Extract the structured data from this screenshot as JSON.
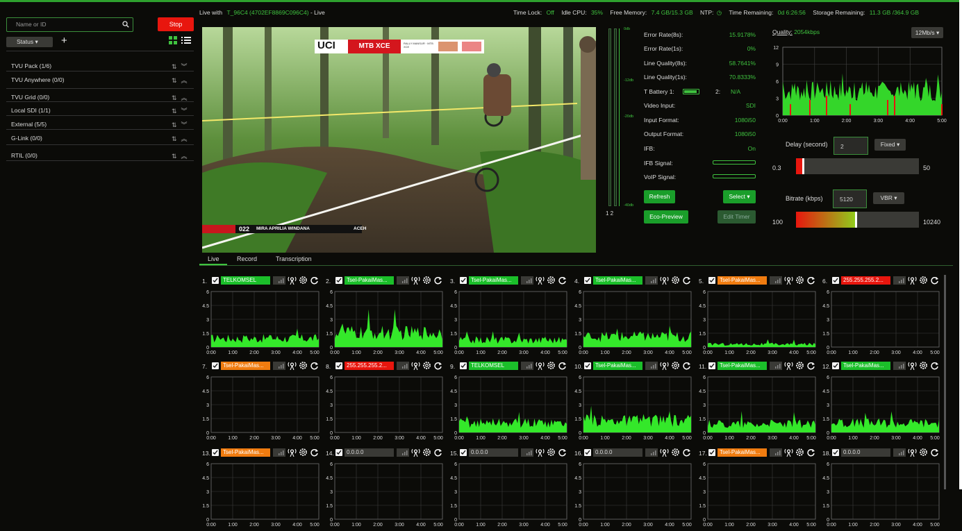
{
  "search": {
    "placeholder": "Name or ID"
  },
  "stop_label": "Stop",
  "status_label": "Status",
  "nav": [
    {
      "label": "TVU Pack (1/6)",
      "expanded": false
    },
    {
      "label": "TVU Anywhere (0/0)",
      "expanded": true
    },
    {
      "label": "TVU Grid (0/0)",
      "expanded": true
    },
    {
      "label": "Local SDI (1/1)",
      "expanded": false
    },
    {
      "label": "External (5/5)",
      "expanded": false
    },
    {
      "label": "G-Link (0/0)",
      "expanded": true
    },
    {
      "label": "RTIL (0/0)",
      "expanded": true
    }
  ],
  "topbar": {
    "live_with_label": "Live with",
    "device": "T_96C4 (4702EF8869C096C4)",
    "live_suffix": "- Live",
    "time_lock_label": "Time Lock:",
    "time_lock": "Off",
    "idle_cpu_label": "Idle CPU:",
    "idle_cpu": "35%",
    "free_memory_label": "Free Memory:",
    "free_memory": "7.4 GB/15.3 GB",
    "ntp_label": "NTP:",
    "time_remaining_label": "Time Remaining:",
    "time_remaining": "0d 6:26:56",
    "storage_remaining_label": "Storage Remaining:",
    "storage_remaining": "11.3 GB /364.9 GB"
  },
  "video": {
    "bug_uci": "UCI",
    "bug_event": "MTB XCE",
    "bug_small": "RALLY MANSUR · MTB XCE",
    "lower_number": "022",
    "lower_name": "MIRA APRILIA WINDANA",
    "lower_team": "ACEH"
  },
  "vu": {
    "ticks": [
      "0db",
      "-12db",
      "-20db",
      "-40db"
    ],
    "channels": "1 2"
  },
  "stats": [
    {
      "label": "Error Rate(8s):",
      "value": "15.9178%"
    },
    {
      "label": "Error Rate(1s):",
      "value": "0%"
    },
    {
      "label": "Line Quality(8s):",
      "value": "58.7641%"
    },
    {
      "label": "Line Quality(1s):",
      "value": "70.8333%"
    },
    {
      "label": "T Battery 1:",
      "value": "N/A",
      "extra": "2:"
    },
    {
      "label": "Video Input:",
      "value": "SDI"
    },
    {
      "label": "Input Format:",
      "value": "1080i50"
    },
    {
      "label": "Output Format:",
      "value": "1080i50"
    },
    {
      "label": "IFB:",
      "value": "On"
    },
    {
      "label": "IFB Signal:",
      "value": ""
    },
    {
      "label": "VoIP Signal:",
      "value": ""
    }
  ],
  "buttons": {
    "refresh": "Refresh",
    "select": "Select",
    "eco_preview": "Eco-Preview",
    "edit_timer": "Edit Timer"
  },
  "quality": {
    "label": "Quality:",
    "value": "2054kbps",
    "rate_select": "12Mb/s",
    "y_ticks": [
      "12",
      "9",
      "6",
      "3",
      "0"
    ],
    "x_ticks": [
      "0:00",
      "1:00",
      "2:00",
      "3:00",
      "4:00",
      "5:00"
    ]
  },
  "delay": {
    "label": "Delay (second)",
    "value": "2",
    "mode": "Fixed",
    "min": "0.3",
    "max": "50",
    "level": 0.06
  },
  "bitrate": {
    "label": "Bitrate (kbps)",
    "value": "5120",
    "mode": "VBR",
    "min": "100",
    "max": "10240",
    "level": 0.49
  },
  "tabs": [
    "Live",
    "Record",
    "Transcription"
  ],
  "small_chart": {
    "y_ticks": [
      "6",
      "4.5",
      "3",
      "1.5",
      "0"
    ],
    "x_ticks": [
      "0:00",
      "1:00",
      "2:00",
      "3:00",
      "4:00",
      "5:00"
    ]
  },
  "colors": {
    "green": "#3fc23f",
    "orange": "#f07c10",
    "red": "#e8160e",
    "gray": "#3a3a36"
  },
  "cards": [
    {
      "num": "1.",
      "name": "TELKOMSEL",
      "state": "green",
      "level": 0.18
    },
    {
      "num": "2.",
      "name": "Tsel-PakaiMas...",
      "state": "green",
      "level": 0.3
    },
    {
      "num": "3.",
      "name": "Tsel-PakaiMas...",
      "state": "green",
      "level": 0.15
    },
    {
      "num": "4.",
      "name": "Tsel-PakaiMas...",
      "state": "green",
      "level": 0.22
    },
    {
      "num": "5.",
      "name": "Tsel-PakaiMas...",
      "state": "orange",
      "level": 0.06
    },
    {
      "num": "6.",
      "name": "255.255.255.2...",
      "state": "red",
      "level": 0
    },
    {
      "num": "7.",
      "name": "Tsel-PakaiMas...",
      "state": "orange",
      "level": 0
    },
    {
      "num": "8.",
      "name": "255.255.255.2...",
      "state": "red",
      "level": 0
    },
    {
      "num": "9.",
      "name": "TELKOMSEL",
      "state": "green",
      "level": 0.2
    },
    {
      "num": "10.",
      "name": "Tsel-PakaiMas...",
      "state": "green",
      "level": 0.25
    },
    {
      "num": "11.",
      "name": "Tsel-PakaiMas...",
      "state": "green",
      "level": 0.18
    },
    {
      "num": "12.",
      "name": "Tsel-PakaiMas...",
      "state": "green",
      "level": 0.2
    },
    {
      "num": "13.",
      "name": "Tsel-PakaiMas...",
      "state": "orange",
      "level": 0
    },
    {
      "num": "14.",
      "name": "0.0.0.0",
      "state": "gray",
      "level": 0
    },
    {
      "num": "15.",
      "name": "0.0.0.0",
      "state": "gray",
      "level": 0
    },
    {
      "num": "16.",
      "name": "0.0.0.0",
      "state": "gray",
      "level": 0
    },
    {
      "num": "17.",
      "name": "Tsel-PakaiMas...",
      "state": "orange",
      "level": 0
    },
    {
      "num": "18.",
      "name": "0.0.0.0",
      "state": "gray",
      "level": 0
    }
  ]
}
